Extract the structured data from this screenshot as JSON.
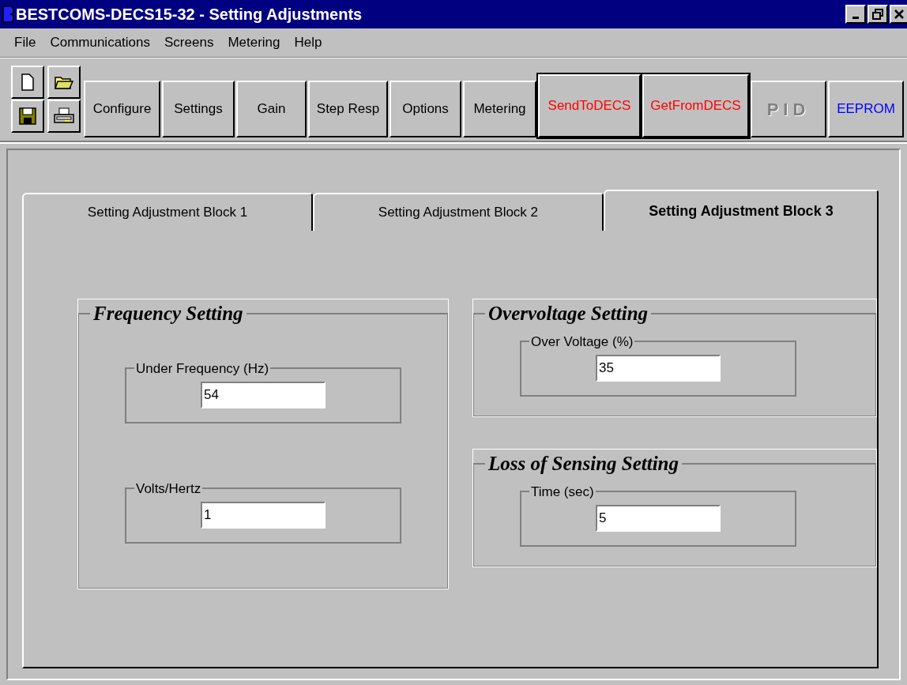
{
  "window": {
    "title": "BESTCOMS-DECS15-32 - Setting Adjustments"
  },
  "menu": [
    "File",
    "Communications",
    "Screens",
    "Metering",
    "Help"
  ],
  "toolbar": {
    "icon_buttons": [
      {
        "kind": "new"
      },
      {
        "kind": "open"
      },
      {
        "kind": "save"
      },
      {
        "kind": "print"
      }
    ],
    "buttons": [
      {
        "label": "Configure",
        "color": "#000000",
        "disabled": false,
        "emphasized": false
      },
      {
        "label": "Settings",
        "color": "#000000",
        "disabled": false,
        "emphasized": false
      },
      {
        "label": "Gain",
        "color": "#000000",
        "disabled": false,
        "emphasized": false
      },
      {
        "label": "Step Resp",
        "color": "#000000",
        "disabled": false,
        "emphasized": false
      },
      {
        "label": "Options",
        "color": "#000000",
        "disabled": false,
        "emphasized": false
      },
      {
        "label": "Metering",
        "color": "#000000",
        "disabled": false,
        "emphasized": false
      },
      {
        "label": "SendToDECS",
        "color": "#ff0000",
        "disabled": false,
        "emphasized": true
      },
      {
        "label": "GetFromDECS",
        "color": "#ff0000",
        "disabled": false,
        "emphasized": true
      },
      {
        "label": "PID",
        "color": "#808080",
        "disabled": true,
        "emphasized": false
      },
      {
        "label": "EEPROM",
        "color": "#0000ff",
        "disabled": false,
        "emphasized": false
      }
    ]
  },
  "tabs": [
    {
      "label": "Setting Adjustment Block 1",
      "selected": false
    },
    {
      "label": "Setting Adjustment Block 2",
      "selected": false
    },
    {
      "label": "Setting Adjustment Block 3",
      "selected": true
    }
  ],
  "groups": [
    {
      "title": "Frequency Setting",
      "fields": [
        {
          "label": "Under Frequency (Hz)",
          "value": "54"
        },
        {
          "label": "Volts/Hertz",
          "value": "1"
        }
      ]
    },
    {
      "title": "Overvoltage Setting",
      "fields": [
        {
          "label": "Over Voltage (%)",
          "value": "35"
        }
      ]
    },
    {
      "title": "Loss of Sensing Setting",
      "fields": [
        {
          "label": "Time (sec)",
          "value": "5"
        }
      ]
    }
  ]
}
